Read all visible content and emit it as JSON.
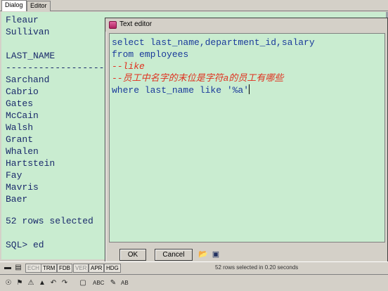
{
  "tabs": [
    {
      "label": "Dialog"
    },
    {
      "label": "Editor"
    }
  ],
  "output": {
    "lines": [
      "Fleaur",
      "Sullivan",
      "",
      "LAST_NAME",
      "-------------------------",
      "Sarchand",
      "Cabrio",
      "Gates",
      "McCain",
      "Walsh",
      "Grant",
      "Whalen",
      "Hartstein",
      "Fay",
      "Mavris",
      "Baer",
      "",
      "52 rows selected",
      "",
      "SQL> ed"
    ]
  },
  "editor": {
    "title": "Text editor",
    "code": {
      "line1": "select last_name,department_id,salary",
      "line2": "from employees",
      "line3": "--like",
      "line4": "--员工中名字的末位是字符a的员工有哪些",
      "line5": "where last_name like '%a'"
    },
    "ok_label": "OK",
    "cancel_label": "Cancel"
  },
  "toolbar": {
    "buttons": [
      "ECH",
      "TRM",
      "FDB",
      "VER",
      "APR",
      "HDG"
    ],
    "status": "52 rows selected in 0.20 seconds",
    "tools2": [
      "ABC",
      "AB"
    ]
  },
  "colors": {
    "output_bg": "#c9ecd0",
    "code_keyword": "#1a3a9b",
    "code_comment": "#e0301e"
  }
}
